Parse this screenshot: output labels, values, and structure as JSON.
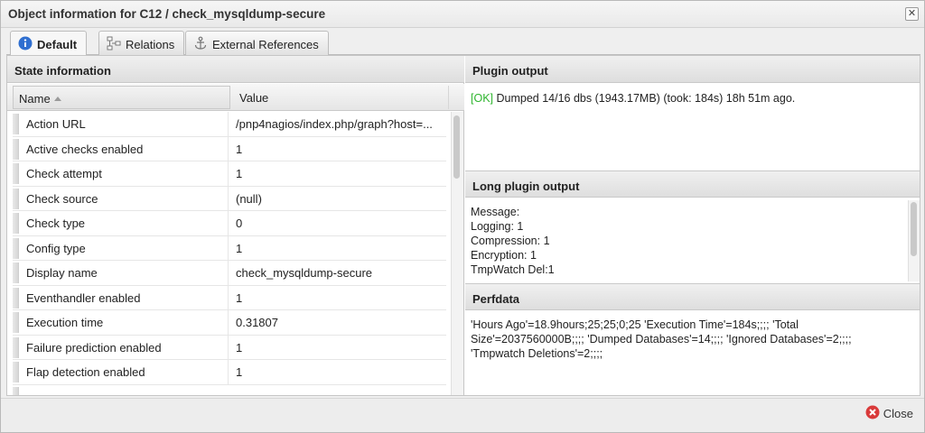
{
  "window": {
    "title": "Object information for C12 / check_mysqldump-secure",
    "close_glyph": "✕"
  },
  "tabs": [
    {
      "label": "Default",
      "icon": "info-icon",
      "active": true
    },
    {
      "label": "Relations",
      "icon": "relations-icon",
      "active": false
    },
    {
      "label": "External References",
      "icon": "anchor-icon",
      "active": false
    }
  ],
  "state": {
    "title": "State information",
    "columns": {
      "name": "Name",
      "value": "Value"
    },
    "rows": [
      {
        "name": "Action URL",
        "value": "/pnp4nagios/index.php/graph?host=..."
      },
      {
        "name": "Active checks enabled",
        "value": "1"
      },
      {
        "name": "Check attempt",
        "value": "1"
      },
      {
        "name": "Check source",
        "value": "(null)"
      },
      {
        "name": "Check type",
        "value": "0"
      },
      {
        "name": "Config type",
        "value": "1"
      },
      {
        "name": "Display name",
        "value": "check_mysqldump-secure"
      },
      {
        "name": "Eventhandler enabled",
        "value": "1"
      },
      {
        "name": "Execution time",
        "value": "0.31807"
      },
      {
        "name": "Failure prediction enabled",
        "value": "1"
      },
      {
        "name": "Flap detection enabled",
        "value": "1"
      }
    ]
  },
  "plugin_output": {
    "title": "Plugin output",
    "status": "[OK]",
    "text": " Dumped 14/16 dbs (1943.17MB) (took: 184s) 18h 51m ago."
  },
  "long_output": {
    "title": "Long plugin output",
    "lines": [
      "Message:",
      "Logging: 1",
      "Compression: 1",
      "Encryption: 1",
      "TmpWatch Del:1"
    ]
  },
  "perfdata": {
    "title": "Perfdata",
    "lines": [
      "'Hours Ago'=18.9hours;25;25;0;25 'Execution Time'=184s;;;; 'Total",
      "Size'=2037560000B;;;; 'Dumped Databases'=14;;;; 'Ignored Databases'=2;;;;",
      "'Tmpwatch Deletions'=2;;;;"
    ]
  },
  "footer": {
    "close_label": "Close",
    "close_icon": "close-circle-icon"
  },
  "colors": {
    "ok_status": "#2fb52f",
    "close_icon": "#d93a3a",
    "info_icon": "#2f6fd0"
  }
}
